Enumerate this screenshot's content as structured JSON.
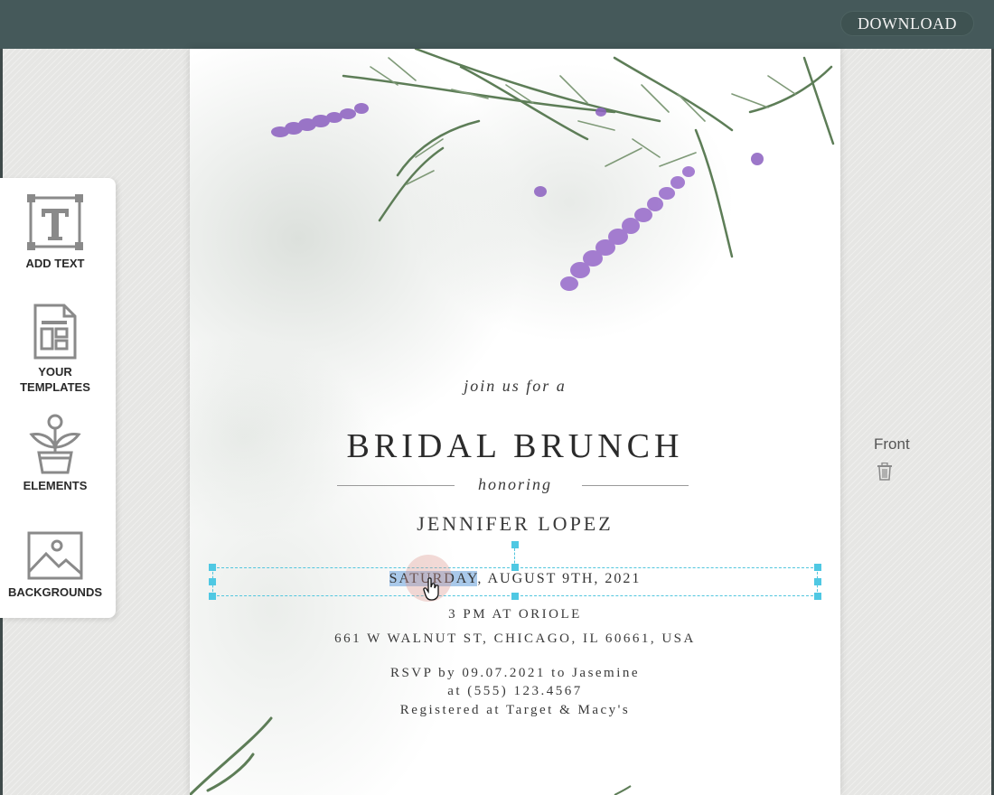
{
  "topbar": {
    "download_label": "DOWNLOAD"
  },
  "toolbar": {
    "items": [
      {
        "label": "ADD TEXT",
        "icon": "text-icon"
      },
      {
        "label": "YOUR\nTEMPLATES",
        "label_line1": "YOUR",
        "label_line2": "TEMPLATES",
        "icon": "template-icon"
      },
      {
        "label": "ELEMENTS",
        "icon": "plant-icon"
      },
      {
        "label": "BACKGROUNDS",
        "icon": "image-icon"
      }
    ]
  },
  "card": {
    "join": "join us for a",
    "title": "BRIDAL BRUNCH",
    "honoring": "honoring",
    "honoree": "JENNIFER LOPEZ",
    "date_selected": "SATURDAY",
    "date_rest": ", AUGUST 9TH, 2021",
    "time": "3 PM AT ORIOLE",
    "address": "661 W WALNUT ST, CHICAGO, IL 60661, USA",
    "rsvp_line1": "RSVP by 09.07.2021 to Jasemine",
    "rsvp_line2": "at (555) 123.4567",
    "rsvp_line3": "Registered at Target & Macy's"
  },
  "side": {
    "front_label": "Front"
  },
  "colors": {
    "topbar": "#45595a",
    "selection": "#52c6de",
    "lavender": "#8b5fc0",
    "leaf": "#5a7a55"
  }
}
